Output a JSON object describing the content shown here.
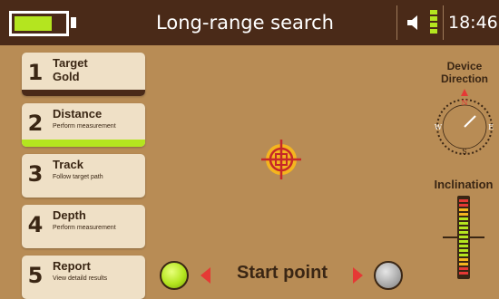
{
  "header": {
    "title": "Long-range search",
    "time": "18:46",
    "battery_level": 0.75,
    "volume_bars": 4
  },
  "menu": {
    "items": [
      {
        "number": "1",
        "title": "Target",
        "subtitle": "Gold"
      },
      {
        "number": "2",
        "title": "Distance",
        "subtitle": "Perform measurement"
      },
      {
        "number": "3",
        "title": "Track",
        "subtitle": "Follow target path"
      },
      {
        "number": "4",
        "title": "Depth",
        "subtitle": "Perform measurement"
      },
      {
        "number": "5",
        "title": "Report",
        "subtitle": "View detaild results"
      }
    ]
  },
  "device_direction": {
    "label_line1": "Device",
    "label_line2": "Direction",
    "north": "N",
    "east": "E",
    "south": "S",
    "west": "W"
  },
  "inclination": {
    "label": "Inclination"
  },
  "start_point": {
    "label": "Start point"
  },
  "colors": {
    "background": "#b88c55",
    "header": "#4a2a18",
    "accent_green": "#b4e51f",
    "arrow_red": "#e53935"
  }
}
